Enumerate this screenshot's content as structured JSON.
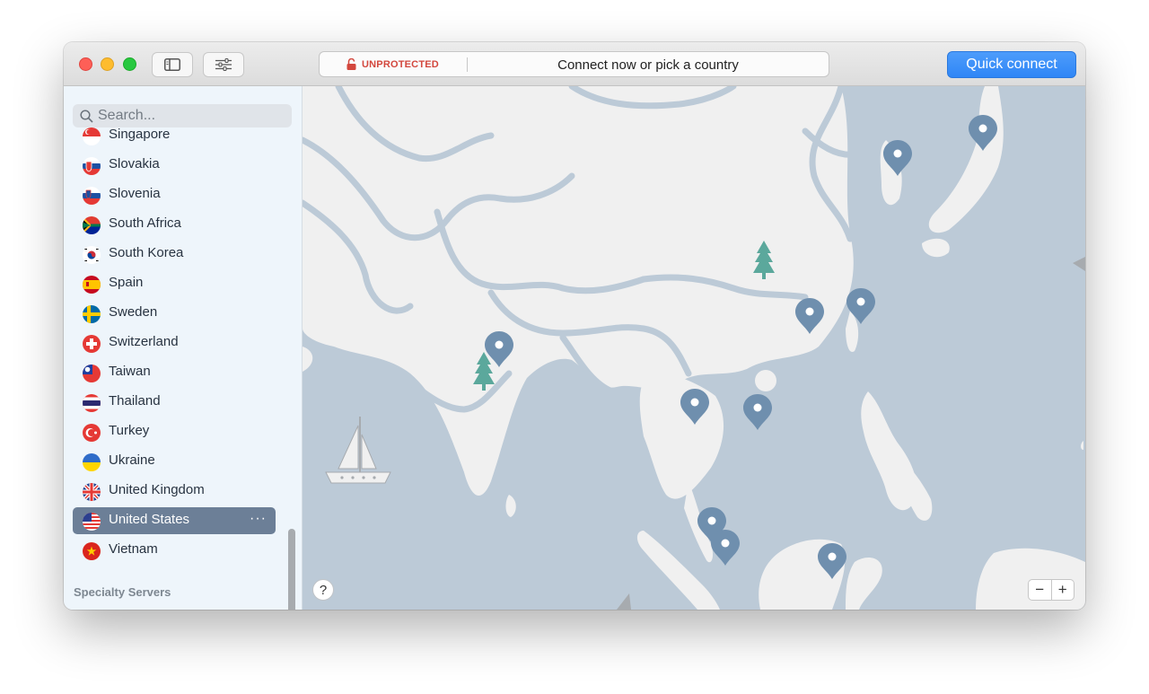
{
  "titlebar": {
    "status": "UNPROTECTED",
    "message": "Connect now or pick a country",
    "quick_connect": "Quick connect"
  },
  "search": {
    "placeholder": "Search..."
  },
  "countries": [
    {
      "name": "Singapore"
    },
    {
      "name": "Slovakia"
    },
    {
      "name": "Slovenia"
    },
    {
      "name": "South Africa"
    },
    {
      "name": "South Korea"
    },
    {
      "name": "Spain"
    },
    {
      "name": "Sweden"
    },
    {
      "name": "Switzerland"
    },
    {
      "name": "Taiwan"
    },
    {
      "name": "Thailand"
    },
    {
      "name": "Turkey"
    },
    {
      "name": "Ukraine"
    },
    {
      "name": "United Kingdom"
    },
    {
      "name": "United States",
      "selected": true
    },
    {
      "name": "Vietnam"
    }
  ],
  "selected_more": "···",
  "specialty_label": "Specialty Servers",
  "map": {
    "help": "?",
    "zoom_out": "−",
    "zoom_in": "+"
  },
  "colors": {
    "accent": "#2f86f6",
    "unprotected": "#d3473d",
    "selected_row": "#6c7f97",
    "sea": "#bccad7",
    "land": "#f0f0f0",
    "pin": "#6f8fae",
    "tree": "#5ba89c"
  }
}
